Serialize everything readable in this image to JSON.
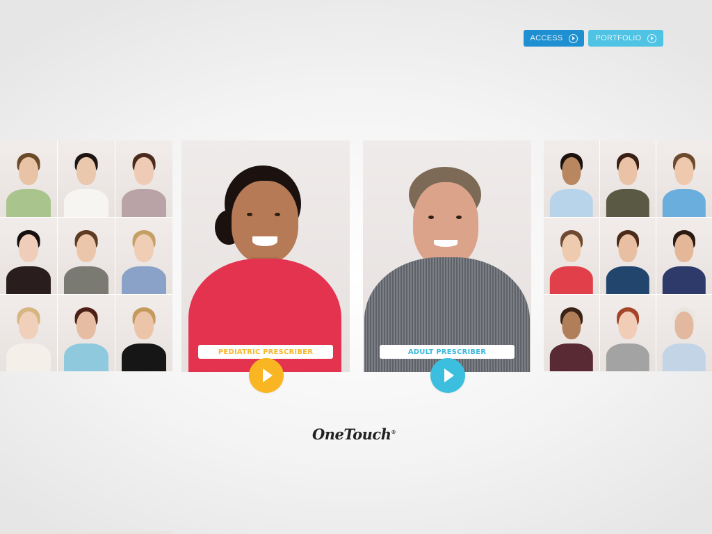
{
  "nav": {
    "access_label": "ACCESS",
    "portfolio_label": "PORTFOLIO",
    "access_color": "#1e8fd0",
    "portfolio_color": "#4fc3e3"
  },
  "features": {
    "pediatric": {
      "label": "PEDIATRIC PRESCRIBER",
      "accent": "#f9b522",
      "icon": "play-icon"
    },
    "adult": {
      "label": "ADULT PRESCRIBER",
      "accent": "#3cbfdf",
      "icon": "play-icon"
    }
  },
  "brand": {
    "logo_text": "OneTouch",
    "registered": "®"
  },
  "grids": {
    "left": [
      {
        "shirt": "#a9c58d",
        "hair": "#6b4a2a",
        "skin": "#e8c3a6"
      },
      {
        "shirt": "#f7f5f1",
        "hair": "#1d1512",
        "skin": "#e9c8ad"
      },
      {
        "shirt": "#b9a3a6",
        "hair": "#4a2a1c",
        "skin": "#efcbb5"
      },
      {
        "shirt": "#2a1d1d",
        "hair": "#150f0d",
        "skin": "#f0cdb8"
      },
      {
        "shirt": "#7a7a72",
        "hair": "#5e3c22",
        "skin": "#ecc6aa"
      },
      {
        "shirt": "#8ba2c8",
        "hair": "#c5a064",
        "skin": "#f0cdb5"
      },
      {
        "shirt": "#f4efe9",
        "hair": "#d6b580",
        "skin": "#f0d0bb"
      },
      {
        "shirt": "#8fc9de",
        "hair": "#4b2016",
        "skin": "#e6bda3"
      },
      {
        "shirt": "#161616",
        "hair": "#c49a5c",
        "skin": "#ecc5a8"
      }
    ],
    "right": [
      {
        "shirt": "#b8d4ea",
        "hair": "#1a120e",
        "skin": "#b8875f"
      },
      {
        "shirt": "#5a5a44",
        "hair": "#3a2014",
        "skin": "#eac2a6"
      },
      {
        "shirt": "#6aaede",
        "hair": "#6e4a2c",
        "skin": "#eec9ae"
      },
      {
        "shirt": "#e1404a",
        "hair": "#6e4a32",
        "skin": "#eecaaf"
      },
      {
        "shirt": "#22456e",
        "hair": "#4b2a18",
        "skin": "#e8bfa2"
      },
      {
        "shirt": "#2e3b6a",
        "hair": "#2a1a12",
        "skin": "#e3b797"
      },
      {
        "shirt": "#5a2a34",
        "hair": "#3a2316",
        "skin": "#b07f5a"
      },
      {
        "shirt": "#a3a3a3",
        "hair": "#a4452a",
        "skin": "#f1cdb8"
      },
      {
        "shirt": "#c3d4e6",
        "hair": "#e9e6e2",
        "skin": "#e2b99f"
      }
    ]
  }
}
